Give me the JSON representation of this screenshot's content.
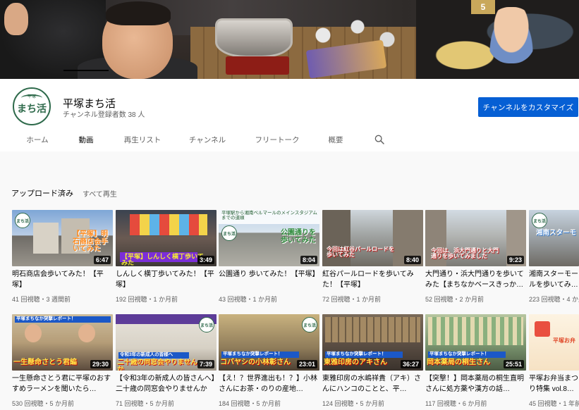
{
  "channel": {
    "name": "平塚まち活",
    "subscribers": "チャンネル登録者数 38 人",
    "avatar_text": "まち活",
    "avatar_sub": "平塚",
    "customize_label": "チャンネルをカスタマイズ"
  },
  "banner": {
    "sign": "5"
  },
  "tabs": [
    {
      "label": "ホーム"
    },
    {
      "label": "動画"
    },
    {
      "label": "再生リスト"
    },
    {
      "label": "チャンネル"
    },
    {
      "label": "フリートーク"
    },
    {
      "label": "概要"
    }
  ],
  "section": {
    "title": "アップロード済み",
    "play_all": "すべて再生"
  },
  "row1": [
    {
      "title": "明石商店会歩いてみた！【平塚】",
      "meta": "41 回視聴・3 週間前",
      "duration": "6:47",
      "overlay": "【平塚】明石商店会手いてみた",
      "logo": "まち活"
    },
    {
      "title": "しんしく横丁歩いてみた！【平塚】",
      "meta": "192 回視聴・1 か月前",
      "duration": "3:49",
      "overlay": "【平塚】しんしく横丁歩いてみた",
      "logo": ""
    },
    {
      "title": "公園通り 歩いてみた！【平塚】",
      "meta": "43 回視聴・1 か月前",
      "duration": "8:04",
      "overlay": "公園通りを歩いてみた",
      "top": "平塚駅から湘南ベルマールのメインスタジアムまでの道順",
      "logo": "まち活"
    },
    {
      "title": "紅谷パールロードを歩いてみた！【平塚】",
      "meta": "72 回視聴・1 か月前",
      "duration": "8:40",
      "overlay": "今回は紅谷パールロードを歩いてみた",
      "logo": ""
    },
    {
      "title": "大門通り・浜大門通りを歩いてみた【まちなかベースきっかけ】",
      "meta": "52 回視聴・2 か月前",
      "duration": "9:23",
      "overlay": "今回は、浜大門通りと大門通りを歩いてみました",
      "logo": ""
    },
    {
      "title": "湘南スターモールを歩いてみた！【平塚】",
      "meta": "223 回視聴・4 か月前",
      "duration": "",
      "overlay": "湘南スターモ",
      "logo": "まち活"
    }
  ],
  "row2": [
    {
      "title": "一生懸命さとう君に平塚のおすすめラーメンを聞いたら…",
      "meta": "530 回視聴・5 か月前",
      "duration": "29:30",
      "overlay": "一生懸命さとう君編",
      "top": "平塚まちなか突撃レポート！",
      "logo": ""
    },
    {
      "title": "【令和3年の新成人の皆さんへ】二十歳の同窓会やりませんか",
      "meta": "71 回視聴・5 か月前",
      "duration": "7:39",
      "overlay": "二十歳の同窓会やりませんか",
      "top": "令和3年の新成人の皆様へ",
      "logo": "まち活"
    },
    {
      "title": "【え！？世界進出も！？】小林さんにお茶・のりの産地…",
      "meta": "184 回視聴・5 か月前",
      "duration": "23:01",
      "overlay": "コバヤシの小林彰さん",
      "top": "平塚まちなか突撃レポート！",
      "logo": "まち活"
    },
    {
      "title": "東雅印房の水嶋祥貴（アキ）さんにハンコのことと、平…",
      "meta": "124 回視聴・5 か月前",
      "duration": "36:27",
      "overlay": "東雅印房のアキさん",
      "top": "平塚まちなか突撃レポート！",
      "logo": ""
    },
    {
      "title": "【突撃！】岡本薬局の桐生直明さんに処方薬や漢方の話…",
      "meta": "117 回視聴・6 か月前",
      "duration": "25:51",
      "overlay": "岡本薬局の桐生さん",
      "top": "平塚まちなか突撃レポート！",
      "logo": ""
    },
    {
      "title": "平塚お弁当まつり特集 vol.8【情報カ…",
      "meta": "45 回視聴・1 年前",
      "duration": "",
      "overlay": "平塚お弁",
      "logo": ""
    }
  ]
}
